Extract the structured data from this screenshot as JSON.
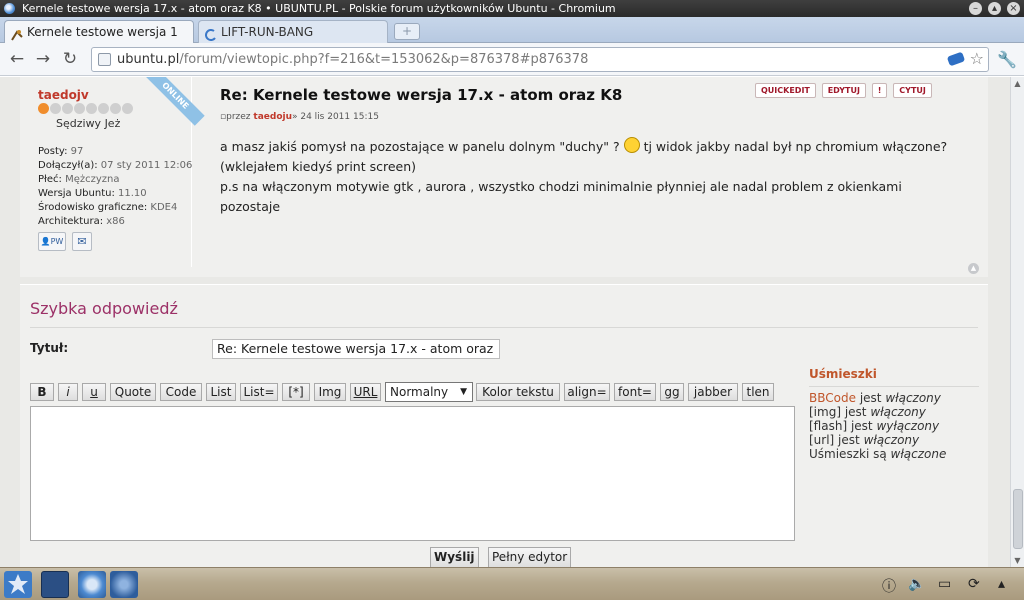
{
  "window": {
    "title": "Kernele testowe wersja 17.x - atom oraz K8 • UBUNTU.PL - Polskie forum użytkowników Ubuntu - Chromium"
  },
  "tabs": [
    {
      "label": "Kernele testowe wersja 1",
      "active": true
    },
    {
      "label": "LIFT-RUN-BANG",
      "active": false
    }
  ],
  "toolbar": {
    "url_host": "ubuntu.pl",
    "url_path": "/forum/viewtopic.php?f=216&t=153062&p=876378#p876378"
  },
  "post": {
    "username": "taedojv",
    "online_label": "ONLINE",
    "rank_title": "Sędziwy Jeż",
    "stats": [
      {
        "label": "Posty:",
        "value": "97"
      },
      {
        "label": "Dołączył(a):",
        "value": "07 sty 2011 12:06"
      },
      {
        "label": "Płeć:",
        "value": "Mężczyzna"
      },
      {
        "label": "Wersja Ubuntu:",
        "value": "11.10"
      },
      {
        "label": "Środowisko graficzne:",
        "value": "KDE4"
      },
      {
        "label": "Architektura:",
        "value": "x86"
      }
    ],
    "pm_label": "PW",
    "title": "Re: Kernele testowe wersja 17.x - atom oraz K8",
    "meta_prefix": "przez",
    "meta_author": "taedoju",
    "meta_date": "» 24 lis 2011 15:15",
    "actions": {
      "quickedit": "QUICKEDIT",
      "edit": "EDYTUJ",
      "report": "!",
      "quote": "CYTUJ"
    },
    "body": {
      "line1a": "a masz jakiś pomysł na pozostające w panelu dolnym \"duchy\" ?",
      "line1b": "tj widok jakby nadal był np chromium włączone?",
      "line2": "(wklejałem kiedyś print screen)",
      "line3": "p.s na włączonym motywie gtk , aurora , wszystko chodzi minimalnie płynniej ale nadal problem z okienkami",
      "line4": "pozostaje"
    }
  },
  "quick_reply": {
    "heading": "Szybka odpowiedź",
    "title_label": "Tytuł:",
    "title_value": "Re: Kernele testowe wersja 17.x - atom oraz",
    "format_buttons": [
      "B",
      "i",
      "u",
      "Quote",
      "Code",
      "List",
      "List=",
      "[*]",
      "Img",
      "URL"
    ],
    "font_size_selected": "Normalny",
    "format_buttons_2": [
      "Kolor tekstu",
      "align=",
      "font=",
      "gg",
      "jabber",
      "tlen"
    ],
    "submit_label": "Wyślij",
    "full_editor_label": "Pełny edytor",
    "smilies_heading": "Uśmieszki",
    "bbcode_link": "BBCode",
    "bbcode_suffix": "jest",
    "bbcode_state": "włączony",
    "img_status": "[img] jest",
    "img_state": "włączony",
    "flash_status": "[flash] jest",
    "flash_state": "wyłączony",
    "url_status": "[url] jest",
    "url_state": "włączony",
    "smilies_status": "Uśmieszki są",
    "smilies_state": "włączone"
  },
  "colors": {
    "accent_red": "#c0392b",
    "heading_purple": "#9c3167",
    "orange": "#c0562b"
  }
}
